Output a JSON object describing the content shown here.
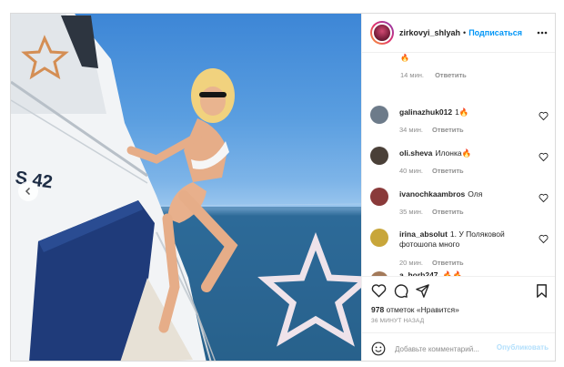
{
  "post": {
    "username": "zirkovyi_shlyah",
    "separator": "•",
    "follow_label": "Подписаться",
    "more_icon": "more-horizontal-icon"
  },
  "photo": {
    "hull_text": "S 42",
    "prev_icon": "chevron-left-icon"
  },
  "comments": {
    "partial_emoji": "🔥",
    "partial": {
      "time": "14 мин.",
      "reply": "Ответить"
    },
    "items": [
      {
        "user": "galinazhuk012",
        "text": "1🔥",
        "time": "34 мин.",
        "reply": "Ответить",
        "avatar_color": "#6d7b8a"
      },
      {
        "user": "oli.sheva",
        "text": "Илонка🔥",
        "time": "40 мин.",
        "reply": "Ответить",
        "avatar_color": "#4a4038"
      },
      {
        "user": "ivanochkaambros",
        "text": "Оля",
        "time": "35 мин.",
        "reply": "Ответить",
        "avatar_color": "#8a3a3a"
      },
      {
        "user": "irina_absolut",
        "text": "1. У Поляковой фотошопа много",
        "time": "20 мин.",
        "reply": "Ответить",
        "avatar_color": "#c8a63a"
      }
    ],
    "last_partial_user": "a_horb247",
    "last_partial_emoji": "🔥🔥"
  },
  "actions": {
    "likes_count": "978",
    "likes_text": "отметок «Нравится»",
    "time_ago": "36 МИНУТ НАЗАД",
    "comment_placeholder": "Добавьте комментарий...",
    "publish_label": "Опубликовать"
  },
  "colors": {
    "accent": "#0095f6",
    "publish_disabled": "#b2dffc",
    "meta_gray": "#8e8e8e"
  }
}
